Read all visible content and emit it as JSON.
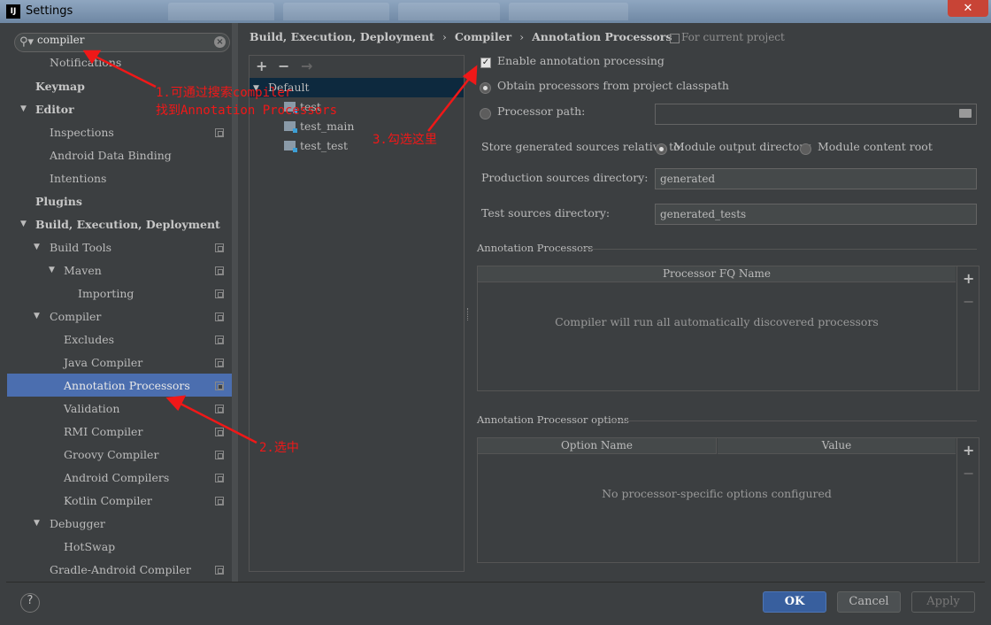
{
  "window": {
    "title": "Settings",
    "app_icon": "IJ",
    "close": "✕"
  },
  "search": {
    "value": "compiler"
  },
  "tree": {
    "notifications": "Notifications",
    "keymap": "Keymap",
    "editor": "Editor",
    "inspections": "Inspections",
    "android_data_binding": "Android Data Binding",
    "intentions": "Intentions",
    "plugins": "Plugins",
    "build_exec_deploy": "Build, Execution, Deployment",
    "build_tools": "Build Tools",
    "maven": "Maven",
    "importing": "Importing",
    "compiler": "Compiler",
    "excludes": "Excludes",
    "java_compiler": "Java Compiler",
    "annotation_processors": "Annotation Processors",
    "validation": "Validation",
    "rmi_compiler": "RMI Compiler",
    "groovy_compiler": "Groovy Compiler",
    "android_compilers": "Android Compilers",
    "kotlin_compiler": "Kotlin Compiler",
    "debugger": "Debugger",
    "hotswap": "HotSwap",
    "gradle_android_compiler": "Gradle-Android Compiler"
  },
  "breadcrumb": {
    "part1": "Build, Execution, Deployment",
    "sep": "›",
    "part2": "Compiler",
    "part3": "Annotation Processors",
    "scope": "For current project"
  },
  "profiles": {
    "toolbar": {
      "add": "+",
      "remove": "−",
      "move": "→"
    },
    "default": "Default",
    "modules": [
      "test",
      "test_main",
      "test_test"
    ]
  },
  "options": {
    "enable_label": "Enable annotation processing",
    "enable_checked": true,
    "obtain_label": "Obtain processors from project classpath",
    "processor_path_label": "Processor path:",
    "store_label": "Store generated sources relative to:",
    "module_output": "Module output directory",
    "module_content": "Module content root",
    "prod_dir_label": "Production sources directory:",
    "prod_dir_value": "generated",
    "test_dir_label": "Test sources directory:",
    "test_dir_value": "generated_tests"
  },
  "processors_table": {
    "title": "Annotation Processors",
    "header": "Processor FQ Name",
    "empty": "Compiler will run all automatically discovered processors"
  },
  "options_table": {
    "title": "Annotation Processor options",
    "col1": "Option Name",
    "col2": "Value",
    "empty": "No processor-specific options configured"
  },
  "buttons": {
    "help": "?",
    "ok": "OK",
    "cancel": "Cancel",
    "apply": "Apply"
  },
  "annotations": {
    "step1_line1": "1.可通过搜索compiler",
    "step1_line2": "找到Annotation Processors",
    "step2": "2.选中",
    "step3": "3.勾选这里"
  },
  "colors": {
    "selection": "#4b6eaf",
    "annotation": "#f01818",
    "ok_button": "#385f9e"
  }
}
